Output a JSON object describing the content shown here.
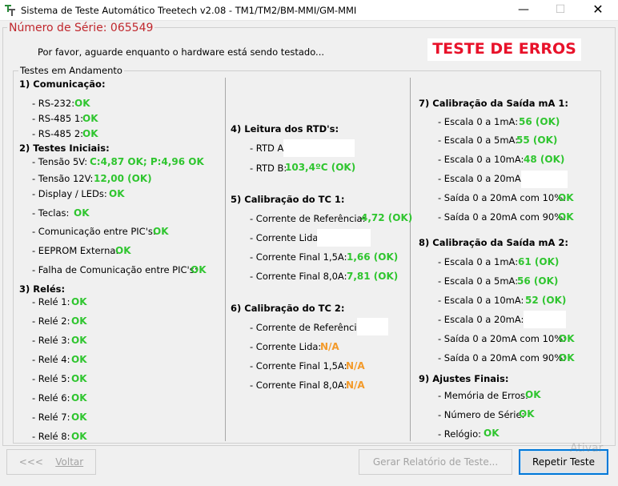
{
  "window": {
    "title": "Sistema de Teste Automático Treetech v2.08 -  TM1/TM2/BM-MMI/GM-MMI",
    "min_glyph": "—",
    "max_glyph": "☐",
    "close_glyph": "✕"
  },
  "serial_label": "Número de Série: 065549",
  "wait_message": "Por favor, aguarde enquanto o hardware está sendo testado...",
  "error_title": "TESTE DE ERROS",
  "group_title": "Testes em Andamento",
  "col1": {
    "s1_title": "1) Comunicação:",
    "rs232_label": "- RS-232:",
    "rs232_value": "OK",
    "rs485_1_label": "- RS-485 1:",
    "rs485_1_value": "OK",
    "rs485_2_label": "- RS-485 2:",
    "rs485_2_value": "OK",
    "s2_title": "2) Testes Iniciais:",
    "v5_label": "- Tensão 5V:",
    "v5_value": "C:4,87 OK; P:4,96 OK",
    "v12_label": "- Tensão 12V:",
    "v12_value": "12,00 (OK)",
    "display_label": "- Display / LEDs:",
    "display_value": "OK",
    "teclas_label": "- Teclas:",
    "teclas_value": "OK",
    "pic_label": "- Comunicação entre PIC's:",
    "pic_value": "OK",
    "eeprom_label": "- EEPROM Externa:",
    "eeprom_value": "OK",
    "falha_label": "- Falha de Comunicação entre PIC's:",
    "falha_value": "OK",
    "s3_title": "3) Relés:",
    "rele1_label": "- Relé 1:",
    "rele1_value": "OK",
    "rele2_label": "- Relé 2:",
    "rele2_value": "OK",
    "rele3_label": "- Relé 3:",
    "rele3_value": "OK",
    "rele4_label": "- Relé 4:",
    "rele4_value": "OK",
    "rele5_label": "- Relé 5:",
    "rele5_value": "OK",
    "rele6_label": "- Relé 6:",
    "rele6_value": "OK",
    "rele7_label": "- Relé 7:",
    "rele7_value": "OK",
    "rele8_label": "- Relé 8:",
    "rele8_value": "OK"
  },
  "col2": {
    "s4_title": "4) Leitura dos RTD's:",
    "rtda_label": "- RTD A:",
    "rtdb_label": "- RTD B:",
    "rtdb_value": "103,4ºC (OK)",
    "s5_title": "5) Calibração do TC 1:",
    "tc1_ref_label": "- Corrente de Referência:",
    "tc1_ref_value": "4,72 (OK)",
    "tc1_lida_label": "- Corrente Lida:",
    "tc1_f15_label": "- Corrente Final 1,5A:",
    "tc1_f15_value": "1,66 (OK)",
    "tc1_f80_label": "- Corrente Final 8,0A:",
    "tc1_f80_value": "7,81 (OK)",
    "s6_title": "6) Calibração do TC 2:",
    "tc2_ref_label": "- Corrente de Referência:",
    "tc2_lida_label": "- Corrente Lida:",
    "tc2_lida_value": "N/A",
    "tc2_f15_label": "- Corrente Final 1,5A:",
    "tc2_f15_value": "N/A",
    "tc2_f80_label": "- Corrente Final 8,0A:",
    "tc2_f80_value": "N/A"
  },
  "col3": {
    "s7_title": "7) Calibração da Saída mA 1:",
    "a_e1_label": "- Escala 0 a 1mA:",
    "a_e1_value": "56 (OK)",
    "a_e5_label": "- Escala 0 a 5mA:",
    "a_e5_value": "55 (OK)",
    "a_e10_label": "- Escala 0 a 10mA:",
    "a_e10_value": "48 (OK)",
    "a_e20_label": "- Escala 0 a 20mA:",
    "a_s10_label": "- Saída 0 a 20mA com 10%:",
    "a_s10_value": "OK",
    "a_s90_label": "- Saída 0 a 20mA com 90%:",
    "a_s90_value": "OK",
    "s8_title": "8) Calibração da Saída mA 2:",
    "b_e1_label": "- Escala 0 a 1mA:",
    "b_e1_value": "61 (OK)",
    "b_e5_label": "- Escala 0 a 5mA:",
    "b_e5_value": "56 (OK)",
    "b_e10_label": "- Escala 0 a 10mA:",
    "b_e10_value": "52 (OK)",
    "b_e20_label": "- Escala 0 a 20mA:",
    "b_s10_label": "- Saída 0 a 20mA com 10%:",
    "b_s10_value": "OK",
    "b_s90_label": "- Saída 0 a 20mA com 90%:",
    "b_s90_value": "OK",
    "s9_title": "9) Ajustes Finais:",
    "mem_label": "- Memória de Erros:",
    "mem_value": "OK",
    "num_label": "- Número de Série:",
    "num_value": "OK",
    "rel_label": "- Relógio:",
    "rel_value": "OK"
  },
  "buttons": {
    "back_arrows": "<<<",
    "back_label": "Voltar",
    "report_label": "Gerar Relatório de Teste...",
    "repeat_label": "Repetir Teste"
  },
  "watermark": "Ativar"
}
